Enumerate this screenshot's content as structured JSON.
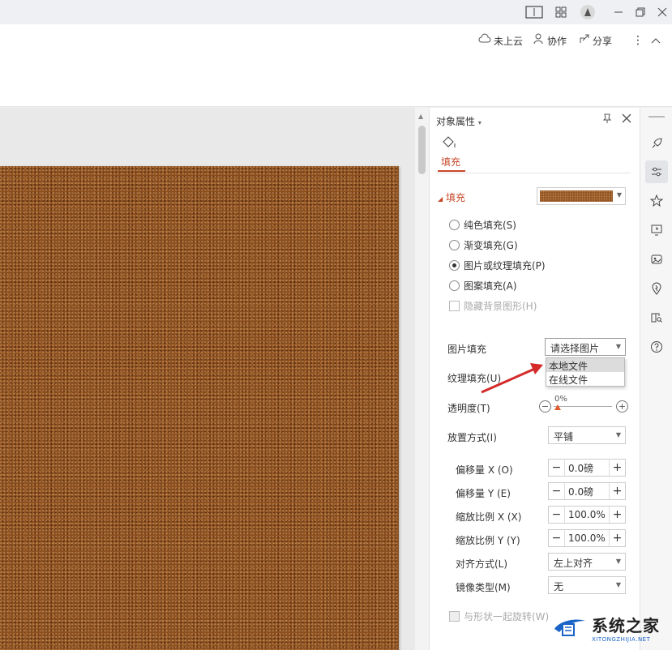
{
  "titlebar": {
    "icons": [
      "reading-mode-icon",
      "grid-icon",
      "user-avatar-icon",
      "minimize-icon",
      "restore-icon",
      "close-icon"
    ]
  },
  "toolbar": {
    "cloud_label": "未上云",
    "collab_label": "协作",
    "share_label": "分享"
  },
  "panel": {
    "title": "对象属性",
    "tab_label": "填充",
    "section_title": "填充",
    "fill_options": [
      {
        "label": "纯色填充(S)",
        "selected": false
      },
      {
        "label": "渐变填充(G)",
        "selected": false
      },
      {
        "label": "图片或纹理填充(P)",
        "selected": true
      },
      {
        "label": "图案填充(A)",
        "selected": false
      }
    ],
    "hide_bg_label": "隐藏背景图形(H)",
    "picture_fill_label": "图片填充",
    "picture_fill_placeholder": "请选择图片",
    "picture_menu": [
      "本地文件",
      "在线文件"
    ],
    "texture_fill_label": "纹理填充(U)",
    "transparency_label": "透明度(T)",
    "transparency_value": "0%",
    "transparency_fraction": 0,
    "placement_label": "放置方式(I)",
    "placement_value": "平铺",
    "offset_x_label": "偏移量 X (O)",
    "offset_x_value": "0.0磅",
    "offset_y_label": "偏移量 Y (E)",
    "offset_y_value": "0.0磅",
    "scale_x_label": "缩放比例 X (X)",
    "scale_x_value": "100.0%",
    "scale_y_label": "缩放比例 Y (Y)",
    "scale_y_value": "100.0%",
    "align_label": "对齐方式(L)",
    "align_value": "左上对齐",
    "mirror_label": "镜像类型(M)",
    "mirror_value": "无",
    "rotate_with_shape_label": "与形状一起旋转(W)"
  },
  "sidebar": {
    "icons": [
      "rocket-icon",
      "adjust-settings-icon",
      "star-effect-icon",
      "transition-icon",
      "image-icon",
      "location-icon",
      "book-search-icon",
      "help-icon"
    ]
  },
  "watermark": {
    "cn": "系统之家",
    "en": "XITONGZHIJIA.NET"
  },
  "colors": {
    "accent": "#c8482a",
    "texture": "#8a4e1f",
    "arrow": "#d42a2a"
  }
}
